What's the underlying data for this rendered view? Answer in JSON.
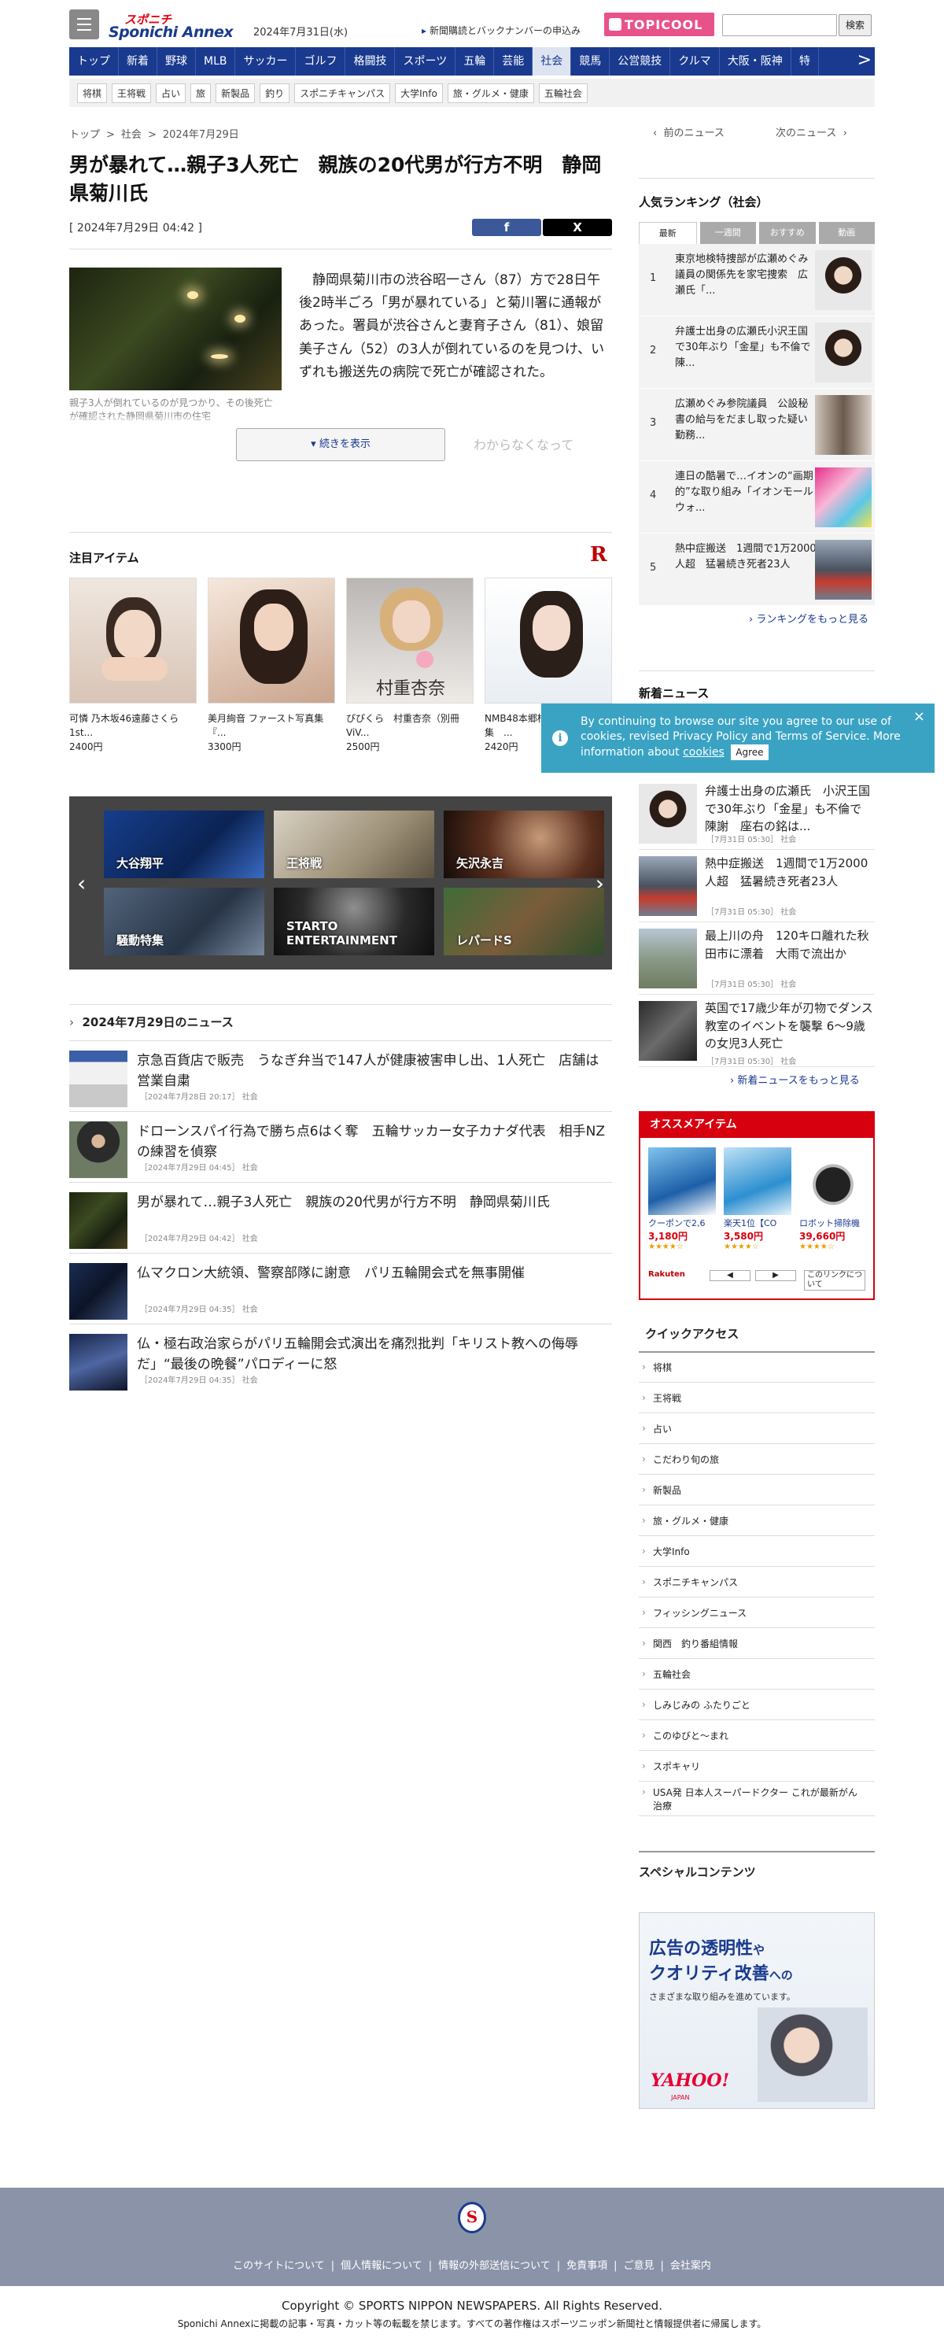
{
  "header": {
    "logo_top": "スポニチ",
    "logo_main": "Sponichi Annex",
    "date": "2024年7月31日(水)",
    "subscribe": "新聞購読とバックナンバーの申込み",
    "topicool": "TOPICOOL",
    "search_button": "検索"
  },
  "nav": {
    "items": [
      "トップ",
      "新着",
      "野球",
      "MLB",
      "サッカー",
      "ゴルフ",
      "格闘技",
      "スポーツ",
      "五輪",
      "芸能",
      "社会",
      "競馬",
      "公営競技",
      "クルマ",
      "大阪・阪神",
      "特"
    ],
    "active_index": 10,
    "more": ">"
  },
  "subnav": [
    "将棋",
    "王将戦",
    "占い",
    "旅",
    "新製品",
    "釣り",
    "スポニチキャンパス",
    "大学Info",
    "旅・グルメ・健康",
    "五輪社会"
  ],
  "breadcrumb": [
    "トップ",
    "社会",
    "2024年7月29日"
  ],
  "prevnext": {
    "prev": "前のニュース",
    "next": "次のニュース"
  },
  "article": {
    "title": "男が暴れて…親子3人死亡　親族の20代男が行方不明　静岡県菊川氏",
    "date": "[ 2024年7月29日 04:42 ]",
    "share_fb": "f",
    "share_x": "X",
    "photo_caption": "親子3人が倒れているのが見つかり、その後死亡が確認された静岡県菊川市の住宅",
    "body": "　静岡県菊川市の渋谷昭一さん（87）方で28日午後2時半ごろ「男が暴れている」と菊川署に通報があった。署員が渋谷さんと妻育子さん（81）、娘留美子さん（52）の3人が倒れているのを見つけ、いずれも搬送先の病院で死亡が確認された。",
    "faded_text": "わからなくなって",
    "more_button": "続きを表示"
  },
  "featured": {
    "heading": "注目アイテム",
    "logo": "R",
    "items": [
      {
        "name": "可憐 乃木坂46遠藤さくら1st...",
        "price": "2400円"
      },
      {
        "name": "美月絢音 ファースト写真集『...",
        "price": "3300円"
      },
      {
        "name": "ぴぴくら　村重杏奈（別冊ViV...",
        "price": "2500円"
      },
      {
        "name": "NMB48本郷柚巴1st写真集　...",
        "price": "2420円"
      }
    ],
    "overlay_name": "村重杏奈"
  },
  "carousel": {
    "tiles": [
      "大谷翔平",
      "王将戦",
      "矢沢永吉",
      "騒動特集",
      "STARTO ENTERTAINMENT",
      "レパードS"
    ]
  },
  "daily_news": {
    "heading": "2024年7月29日のニュース",
    "items": [
      {
        "title": "京急百貨店で販売　うなぎ弁当で147人が健康被害申し出、1人死亡　店舗は営業自粛",
        "meta": "［2024年7月28日 20:17］ 社会"
      },
      {
        "title": "ドローンスパイ行為で勝ち点6はく奪　五輪サッカー女子カナダ代表　相手NZの練習を偵察",
        "meta": "［2024年7月29日 04:45］ 社会"
      },
      {
        "title": "男が暴れて…親子3人死亡　親族の20代男が行方不明　静岡県菊川氏",
        "meta": "［2024年7月29日 04:42］ 社会"
      },
      {
        "title": "仏マクロン大統領、警察部隊に謝意　パリ五輪開会式を無事開催",
        "meta": "［2024年7月29日 04:35］ 社会"
      },
      {
        "title": "仏・極右政治家らがパリ五輪開会式演出を痛烈批判「キリスト教への侮辱だ」“最後の晩餐”パロディーに怒",
        "meta": "［2024年7月29日 04:35］ 社会"
      }
    ]
  },
  "ranking": {
    "heading": "人気ランキング（社会）",
    "tabs": [
      "最新",
      "一週間",
      "おすすめ",
      "動画"
    ],
    "items": [
      {
        "rank": "1",
        "title": "東京地検特捜部が広瀬めぐみ議員の関係先を家宅捜索　広瀬氏「..."
      },
      {
        "rank": "2",
        "title": "弁護士出身の広瀬氏小沢王国で30年ぶり「金星」も不倫で陳..."
      },
      {
        "rank": "3",
        "title": "広瀬めぐみ参院議員　公設秘書の給与をだまし取った疑い　勤務..."
      },
      {
        "rank": "4",
        "title": "連日の酷暑で…イオンの“画期的”な取り組み「イオンモールウォ..."
      },
      {
        "rank": "5",
        "title": "熱中症搬送　1週間で1万2000人超　猛暑続き死者23人"
      }
    ],
    "more": "ランキングをもっと見る"
  },
  "new_news": {
    "heading": "新着ニュース",
    "items": [
      {
        "title": "弁護士出身の広瀬氏　小沢王国で30年ぶり「金星」も不倫で陳謝　座右の銘は...",
        "meta": "［7月31日 05:30］ 社会"
      },
      {
        "title": "熱中症搬送　1週間で1万2000人超　猛暑続き死者23人",
        "meta": "［7月31日 05:30］ 社会"
      },
      {
        "title": "最上川の舟　120キロ離れた秋田市に漂着　大雨で流出か",
        "meta": "［7月31日 05:30］ 社会"
      },
      {
        "title": "英国で17歳少年が刃物でダンス教室のイベントを襲撃 6～9歳の女児3人死亡",
        "meta": "［7月31日 05:30］ 社会"
      }
    ],
    "more": "新着ニュースをもっと見る"
  },
  "cookie": {
    "text": "By continuing to browse our site you agree to our use of cookies, revised Privacy Policy and Terms of Service. More information about",
    "link": "cookies",
    "agree": "Agree",
    "close": "×"
  },
  "osusume": {
    "heading": "オススメアイテム",
    "items": [
      {
        "name": "クーポンで2,6",
        "price": "3,180円",
        "stars": "★★★★☆"
      },
      {
        "name": "楽天1位【CO",
        "price": "3,580円",
        "stars": "★★★★☆"
      },
      {
        "name": "ロボット掃除機",
        "price": "39,660円",
        "stars": "★★★★☆"
      }
    ],
    "rakuten": "Rakuten",
    "prev": "◀",
    "next": "▶",
    "about": "このリンクについて"
  },
  "quick_access": {
    "heading": "クイックアクセス",
    "items": [
      "将棋",
      "王将戦",
      "占い",
      "こだわり旬の旅",
      "新製品",
      "旅・グルメ・健康",
      "大学Info",
      "スポニチキャンパス",
      "フィッシングニュース",
      "関西　釣り番組情報",
      "五輪社会",
      "しみじみの ふたりごと",
      "このゆびと～まれ",
      "スポキャリ",
      "USA発 日本人スーパードクター これが最新がん治療"
    ]
  },
  "special": {
    "heading": "スペシャルコンテンツ",
    "ad_line1": "広告の透明性",
    "ad_line1b": "や",
    "ad_line2": "クオリティ改善",
    "ad_line2b": "への",
    "ad_line3": "さまざまな取り組みを進めています。",
    "brand": "YAHOO!",
    "brand_sub": "JAPAN"
  },
  "footer": {
    "emblem": "S",
    "links": [
      "このサイトについて",
      "個人情報について",
      "情報の外部送信について",
      "免責事項",
      "ご意見",
      "会社案内"
    ],
    "copyright": "Copyright © SPORTS NIPPON NEWSPAPERS. All Rights Reserved.",
    "notice": "Sponichi Annexに掲載の記事・写真・カット等の転載を禁じます。すべての著作権はスポーツニッポン新聞社と情報提供者に帰属します。"
  }
}
